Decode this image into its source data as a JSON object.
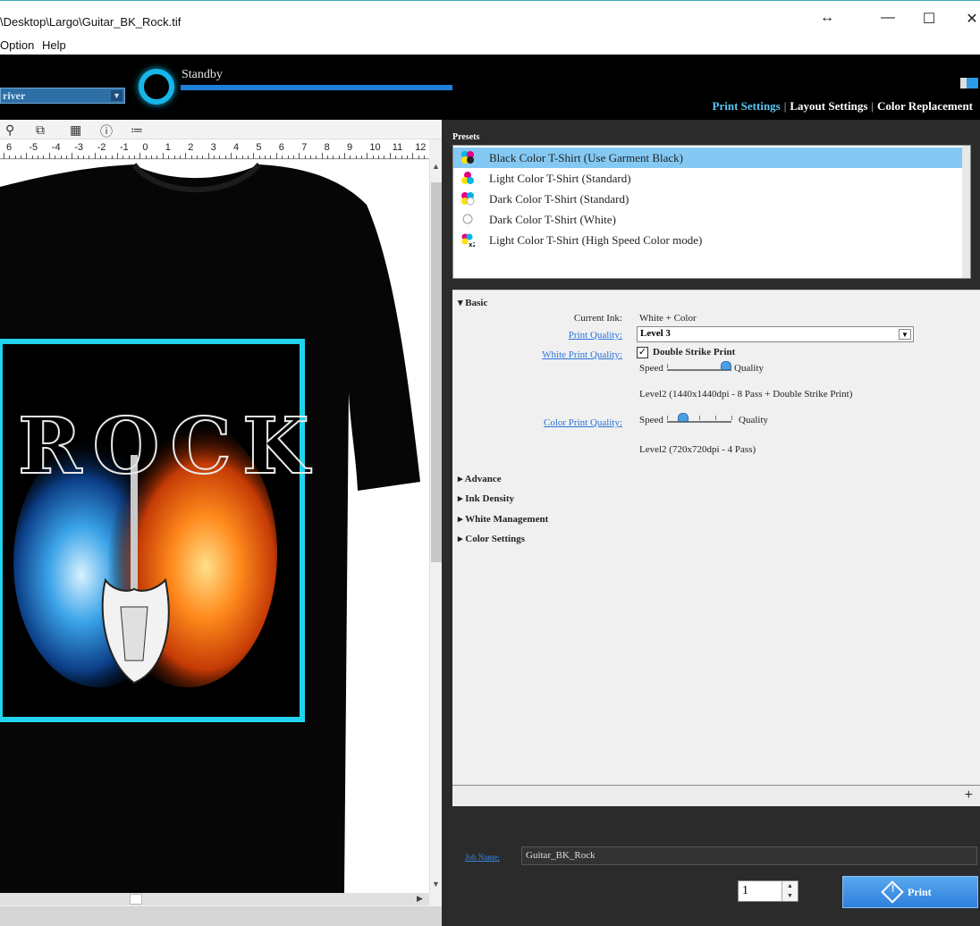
{
  "window": {
    "title": "\\Desktop\\Largo\\Guitar_BK_Rock.tif",
    "controls": {
      "resize": "↔",
      "minimize": "—",
      "maximize": "☐",
      "close": "✕"
    }
  },
  "menu": {
    "items": [
      "Option",
      "Help"
    ]
  },
  "header": {
    "printer": "river",
    "status": "Standby",
    "tabs": [
      "Print Settings",
      "Layout Settings",
      "Color Replacement"
    ],
    "active_tab": "Print Settings",
    "accent": "#16b6e8"
  },
  "ruler": {
    "labels": [
      "6",
      "-5",
      "-4",
      "-3",
      "-2",
      "-1",
      "0",
      "1",
      "2",
      "3",
      "4",
      "5",
      "6",
      "7",
      "8",
      "9",
      "10",
      "11",
      "12"
    ]
  },
  "artwork": {
    "text": "ROCK"
  },
  "presets": {
    "label": "Presets",
    "items": [
      {
        "label": "Black Color T-Shirt (Use Garment Black)",
        "selected": true,
        "icon": "cmyk-flower-icon"
      },
      {
        "label": "Light Color T-Shirt (Standard)",
        "selected": false,
        "icon": "cmy-flower-icon"
      },
      {
        "label": "Dark Color T-Shirt (Standard)",
        "selected": false,
        "icon": "cmyw-flower-icon"
      },
      {
        "label": "Dark Color T-Shirt (White)",
        "selected": false,
        "icon": "white-circle-icon"
      },
      {
        "label": "Light Color T-Shirt (High Speed Color mode)",
        "selected": false,
        "icon": "x2-flower-icon"
      }
    ]
  },
  "basic": {
    "title": "Basic",
    "current_ink_label": "Current Ink:",
    "current_ink_value": "White + Color",
    "print_quality_label": "Print Quality:",
    "print_quality_value": "Level 3",
    "white_quality_label": "White Print Quality:",
    "double_strike_label": "Double Strike Print",
    "double_strike_checked": true,
    "speed_label": "Speed",
    "quality_label": "Quality",
    "white_level_text": "Level2 (1440x1440dpi - 8 Pass + Double Strike Print)",
    "white_slider_level": 1.0,
    "color_quality_label": "Color Print Quality:",
    "color_level_text": "Level2 (720x720dpi - 4 Pass)",
    "color_slider_level": 0.25
  },
  "sections": [
    "Advance",
    "Ink Density",
    "White Management",
    "Color Settings"
  ],
  "job": {
    "label": "Job Name:",
    "value": "Guitar_BK_Rock"
  },
  "copies": {
    "value": "1"
  },
  "print_button": {
    "label": "Print"
  }
}
